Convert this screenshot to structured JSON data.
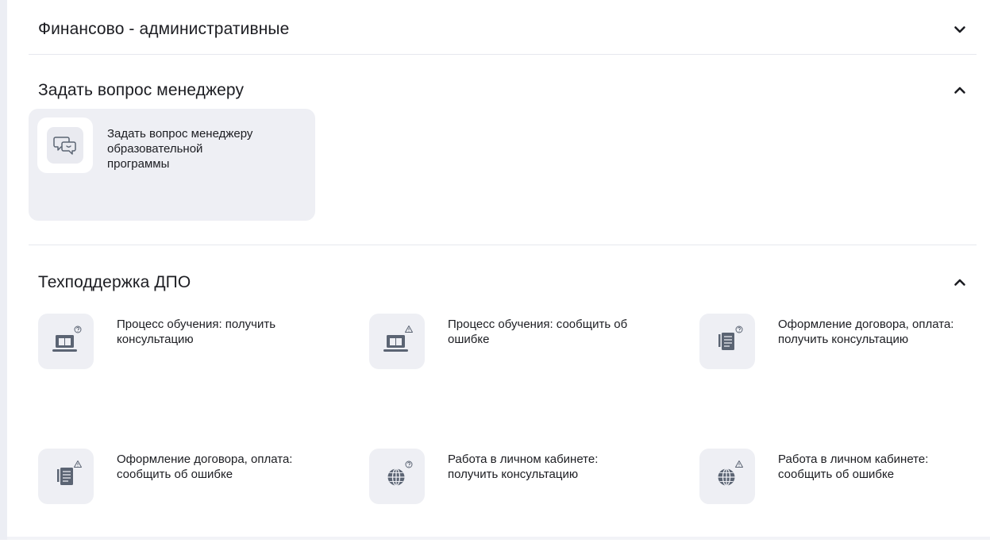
{
  "sections": {
    "financial": {
      "title": "Финансово - административные",
      "expanded": false,
      "chevron_icon": "chevron-down-icon"
    },
    "manager": {
      "title": "Задать вопрос менеджеру",
      "expanded": true,
      "chevron_icon": "chevron-up-icon",
      "card": {
        "label": "Задать вопрос менеджеру образовательной программы",
        "icon": "chat-bubbles-icon"
      }
    },
    "techsupport": {
      "title": "Техподдержка ДПО",
      "expanded": true,
      "chevron_icon": "chevron-up-icon",
      "items": [
        {
          "label": "Процесс обучения: получить консультацию",
          "icon": "laptop-book-question-icon"
        },
        {
          "label": "Процесс обучения: сообщить об ошибке",
          "icon": "laptop-book-warning-icon"
        },
        {
          "label": "Оформление договора, оплата: получить консультацию",
          "icon": "document-question-icon"
        },
        {
          "label": "Оформление договора, оплата: сообщить об ошибке",
          "icon": "document-warning-icon"
        },
        {
          "label": "Работа в личном кабинете: получить консультацию",
          "icon": "globe-question-icon"
        },
        {
          "label": "Работа в личном кабинете: сообщить об ошибке",
          "icon": "globe-warning-icon"
        }
      ]
    }
  },
  "colors": {
    "text": "#1c1d22",
    "card_bg": "#eeeff4",
    "icon_gray": "#5b6473",
    "divider": "#e6e8ee",
    "rail": "#eceef4"
  }
}
